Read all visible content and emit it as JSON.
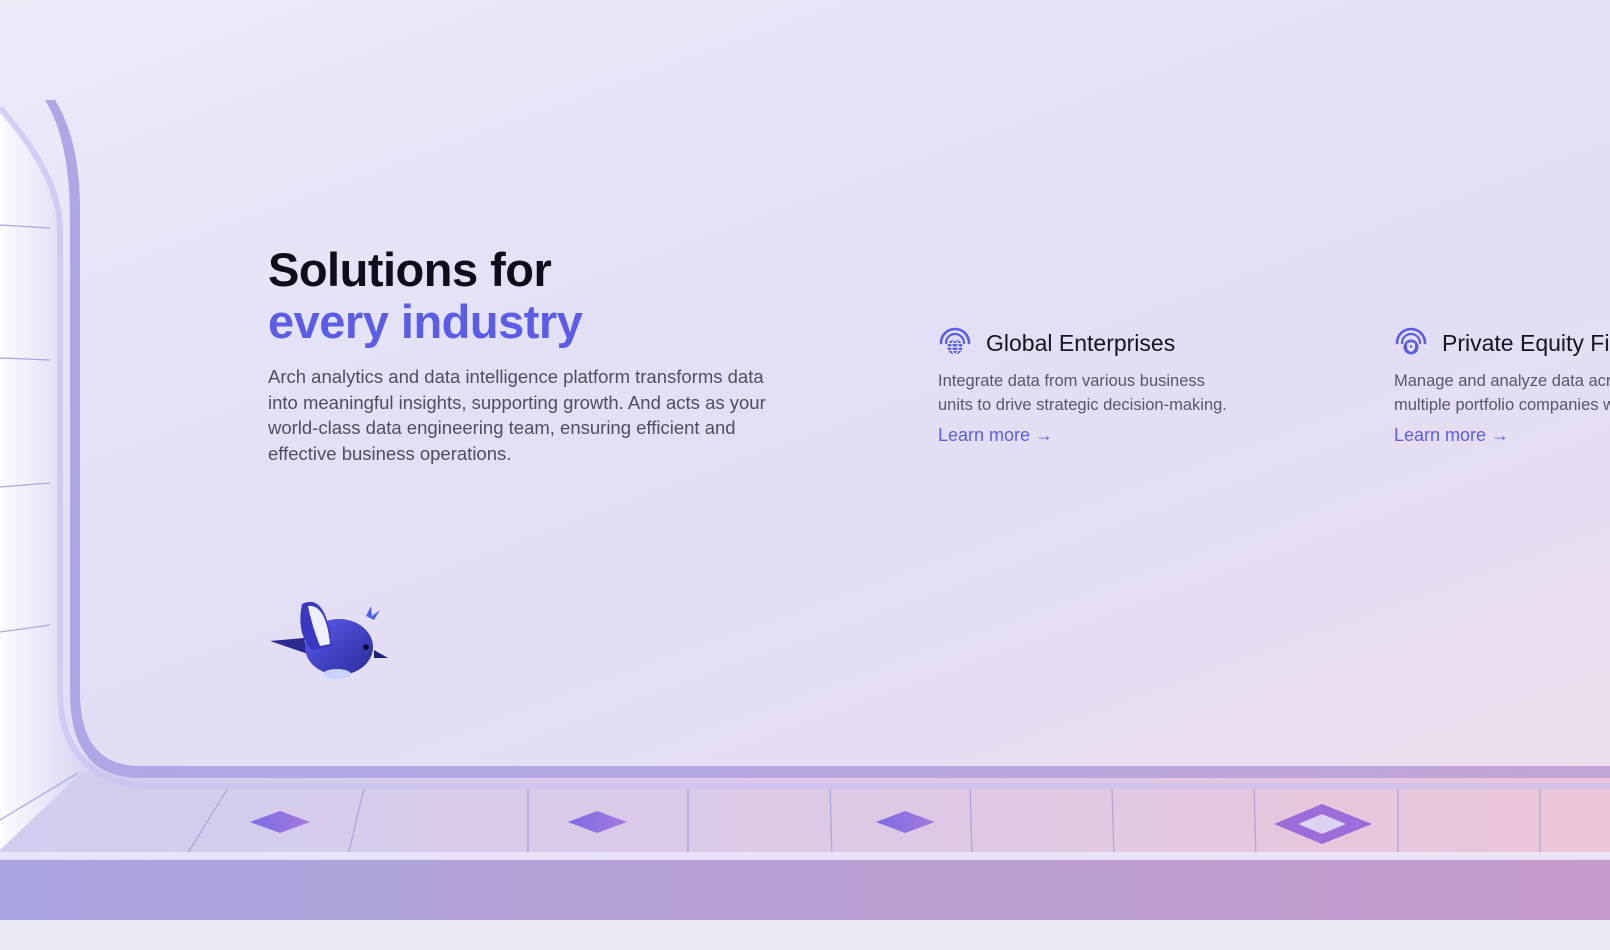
{
  "hero": {
    "title_line1": "Solutions for",
    "title_line2": "every industry",
    "description": "Arch analytics and data intelligence platform transforms data into meaningful insights, supporting growth. And acts as your world-class data engineering team, ensuring efficient and effective business operations."
  },
  "solutions": [
    {
      "icon": "globe-icon",
      "title": "Global Enterprises",
      "description": "Integrate data from various business units to drive strategic decision-making.",
      "link_label": "Learn more →"
    },
    {
      "icon": "shield-icon",
      "title": "Private Equity Firms",
      "description": "Manage and analyze data across multiple portfolio companies with ease.",
      "link_label": "Learn more →"
    }
  ],
  "mascot": {
    "icon": "bird-mascot-icon"
  },
  "colors": {
    "accent": "#5b5de6",
    "heading": "#0e0e1a",
    "body_text": "#4e4e62",
    "frame": "#a99be0",
    "tile": "#8d6cdc"
  }
}
